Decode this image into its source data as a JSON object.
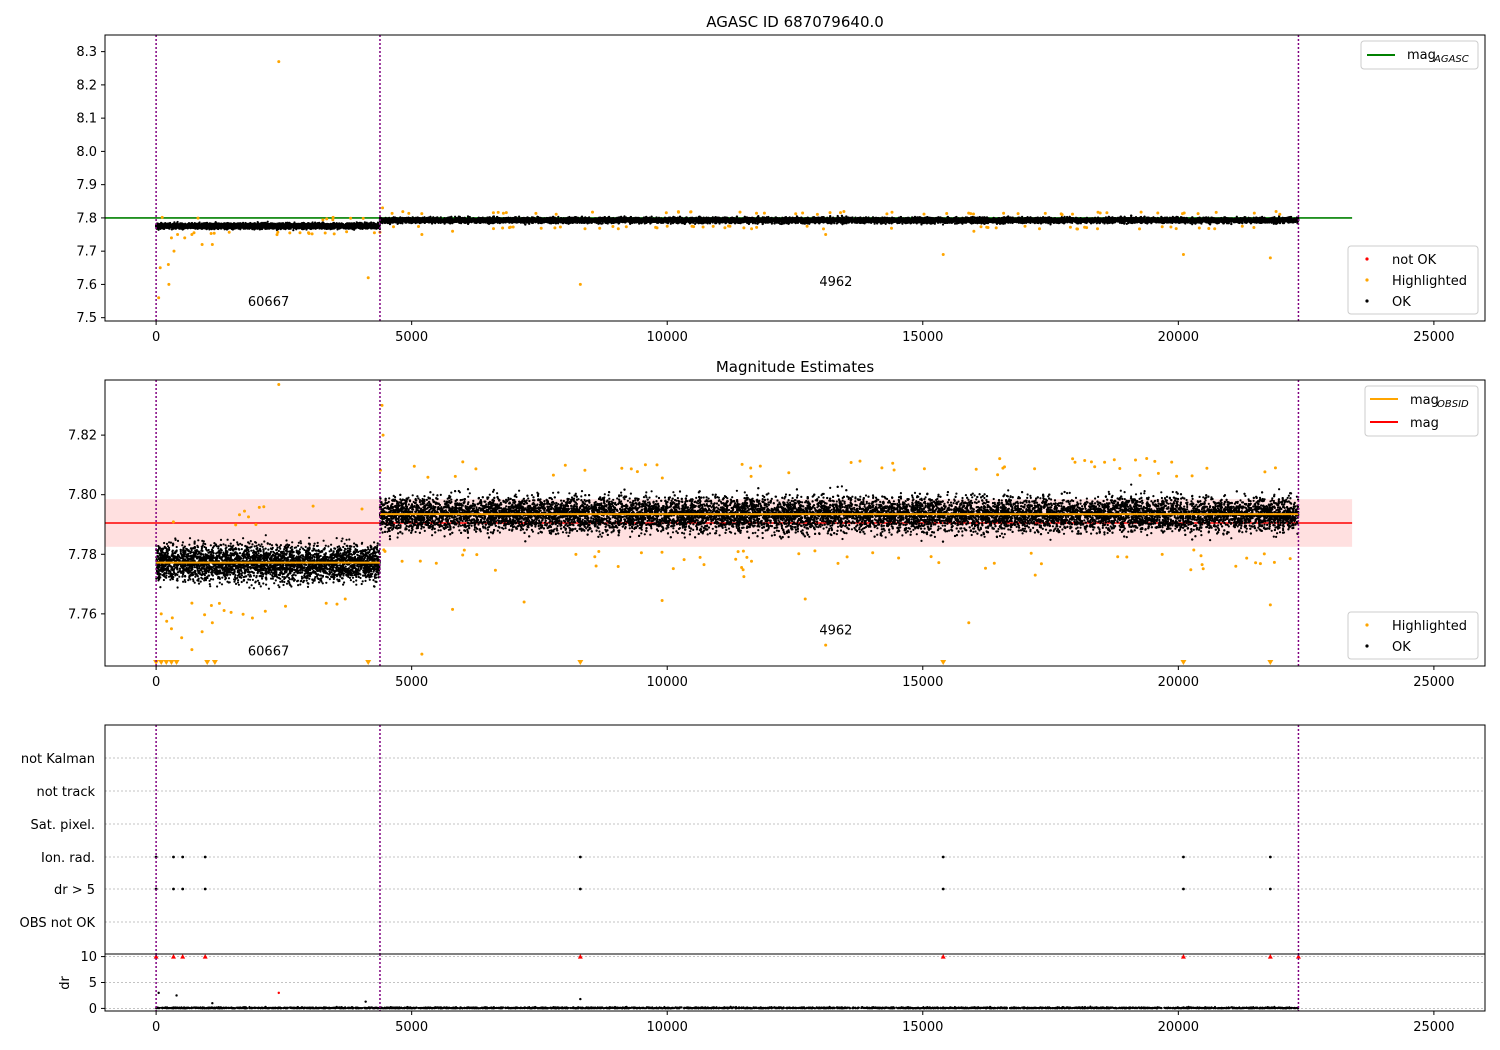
{
  "chart_data": [
    {
      "type": "scatter",
      "title": "AGASC ID 687079640.0",
      "xlim": [
        -1000,
        26000
      ],
      "ylim": [
        7.49,
        8.35
      ],
      "xticks": [
        0,
        5000,
        10000,
        15000,
        20000,
        25000
      ],
      "yticks": [
        7.5,
        7.6,
        7.7,
        7.8,
        7.9,
        8.0,
        8.1,
        8.2,
        8.3
      ],
      "grid": false,
      "legend_top": {
        "placement": "top-right",
        "entries": [
          {
            "label": "mag",
            "sub": "AGASC",
            "color": "#008000",
            "kind": "line"
          }
        ]
      },
      "legend_bottom": {
        "placement": "bottom-right",
        "entries": [
          {
            "label": "not OK",
            "color": "#ff0000",
            "kind": "dot"
          },
          {
            "label": "Highlighted",
            "color": "#ffa500",
            "kind": "dot"
          },
          {
            "label": "OK",
            "color": "#000000",
            "kind": "dot"
          }
        ]
      },
      "reference_lines": [
        {
          "name": "mag_AGASC",
          "y": 7.8,
          "x_range": [
            -1000,
            23400
          ],
          "color": "#008000"
        }
      ],
      "vlines": [
        0,
        4380,
        22350
      ],
      "annotations": [
        {
          "text": "60667",
          "x": 2200,
          "y": 7.535
        },
        {
          "text": "4962",
          "x": 13300,
          "y": 7.595
        }
      ],
      "segments": [
        {
          "obsid": "60667",
          "x_range": [
            0,
            4380
          ],
          "mean": 7.776,
          "spread": 0.006
        },
        {
          "obsid": "4962",
          "x_range": [
            4380,
            22350
          ],
          "mean": 7.793,
          "spread": 0.006
        }
      ],
      "highlighted_points": [
        {
          "x": 2400,
          "y": 8.27
        },
        {
          "x": 80,
          "y": 7.65
        },
        {
          "x": 50,
          "y": 7.56
        },
        {
          "x": 240,
          "y": 7.66
        },
        {
          "x": 250,
          "y": 7.6
        },
        {
          "x": 300,
          "y": 7.74
        },
        {
          "x": 350,
          "y": 7.7
        },
        {
          "x": 420,
          "y": 7.75
        },
        {
          "x": 560,
          "y": 7.74
        },
        {
          "x": 700,
          "y": 7.75
        },
        {
          "x": 900,
          "y": 7.72
        },
        {
          "x": 1100,
          "y": 7.72
        },
        {
          "x": 4150,
          "y": 7.62
        },
        {
          "x": 4430,
          "y": 7.83
        },
        {
          "x": 5200,
          "y": 7.75
        },
        {
          "x": 8300,
          "y": 7.6
        },
        {
          "x": 13100,
          "y": 7.75
        },
        {
          "x": 15400,
          "y": 7.69
        },
        {
          "x": 20100,
          "y": 7.69
        },
        {
          "x": 21800,
          "y": 7.68
        },
        {
          "x": 5800,
          "y": 7.76
        },
        {
          "x": 9800,
          "y": 7.77
        },
        {
          "x": 11500,
          "y": 7.77
        },
        {
          "x": 16000,
          "y": 7.76
        }
      ]
    },
    {
      "type": "scatter",
      "title": "Magnitude Estimates",
      "xlim": [
        -1000,
        26000
      ],
      "ylim": [
        7.7425,
        7.8385
      ],
      "xticks": [
        0,
        5000,
        10000,
        15000,
        20000,
        25000
      ],
      "yticks": [
        7.76,
        7.78,
        7.8,
        7.82
      ],
      "grid": false,
      "legend_top": {
        "placement": "top-right",
        "entries": [
          {
            "label": "mag",
            "sub": "OBSID",
            "color": "#ffa500",
            "kind": "line"
          },
          {
            "label": "mag",
            "sub": "",
            "color": "#ff0000",
            "kind": "line"
          }
        ]
      },
      "legend_bottom": {
        "placement": "bottom-right",
        "entries": [
          {
            "label": "Highlighted",
            "color": "#ffa500",
            "kind": "dot"
          },
          {
            "label": "OK",
            "color": "#000000",
            "kind": "dot"
          }
        ]
      },
      "mag_line": {
        "y": 7.7905,
        "band": [
          7.7825,
          7.7985
        ],
        "x_range": [
          -1000,
          23400
        ],
        "color": "#ff0000"
      },
      "obsid_lines": [
        {
          "obsid": "60667",
          "y": 7.7772,
          "x_range": [
            0,
            4380
          ]
        },
        {
          "obsid": "4962",
          "y": 7.7935,
          "x_range": [
            4380,
            22350
          ]
        }
      ],
      "vlines": [
        0,
        4380,
        22350
      ],
      "annotations": [
        {
          "text": "60667",
          "x": 2200,
          "y": 7.746
        },
        {
          "text": "4962",
          "x": 13300,
          "y": 7.753
        }
      ],
      "segments": [
        {
          "obsid": "60667",
          "x_range": [
            0,
            4380
          ],
          "mean": 7.7772,
          "spread": 0.0045
        },
        {
          "obsid": "4962",
          "x_range": [
            4380,
            22350
          ],
          "mean": 7.7935,
          "spread": 0.0043
        }
      ],
      "highlighted_points": [
        {
          "x": 2400,
          "y": 7.837
        },
        {
          "x": 4420,
          "y": 7.83
        },
        {
          "x": 4440,
          "y": 7.82
        },
        {
          "x": 5200,
          "y": 7.7465
        },
        {
          "x": 5800,
          "y": 7.7615
        },
        {
          "x": 7200,
          "y": 7.764
        },
        {
          "x": 9900,
          "y": 7.7645
        },
        {
          "x": 12700,
          "y": 7.765
        },
        {
          "x": 13100,
          "y": 7.7495
        },
        {
          "x": 15900,
          "y": 7.757
        },
        {
          "x": 21800,
          "y": 7.763
        },
        {
          "x": 11500,
          "y": 7.7725
        },
        {
          "x": 17200,
          "y": 7.773
        },
        {
          "x": 100,
          "y": 7.76
        },
        {
          "x": 300,
          "y": 7.755
        },
        {
          "x": 500,
          "y": 7.752
        },
        {
          "x": 700,
          "y": 7.748
        },
        {
          "x": 900,
          "y": 7.754
        },
        {
          "x": 1100,
          "y": 7.757
        },
        {
          "x": 3700,
          "y": 7.765
        },
        {
          "x": 6000,
          "y": 7.811
        },
        {
          "x": 9800,
          "y": 7.81
        },
        {
          "x": 14200,
          "y": 7.809
        },
        {
          "x": 18300,
          "y": 7.811
        },
        {
          "x": 21900,
          "y": 7.809
        }
      ],
      "below_axis_markers": [
        0,
        100,
        200,
        300,
        400,
        1000,
        1150,
        4150,
        8300,
        15400,
        20100,
        21800
      ]
    },
    {
      "type": "scatter",
      "title": "",
      "xlim": [
        -1000,
        26000
      ],
      "xticks": [
        0,
        5000,
        10000,
        15000,
        20000,
        25000
      ],
      "flag_categories": [
        "not Kalman",
        "not track",
        "Sat. pixel.",
        "Ion. rad.",
        "dr > 5",
        "OBS not OK"
      ],
      "flag_points": {
        "Ion. rad.": [
          0,
          340,
          520,
          960,
          8300,
          15400,
          20100,
          21800
        ],
        "dr > 5": [
          0,
          340,
          520,
          960,
          8300,
          15400,
          20100,
          21800
        ]
      },
      "vlines": [
        0,
        4380,
        22350
      ]
    },
    {
      "type": "scatter",
      "title": "",
      "ylabel": "dr",
      "xlim": [
        -1000,
        26000
      ],
      "ylim": [
        -0.5,
        10.5
      ],
      "xticks": [
        0,
        5000,
        10000,
        15000,
        20000,
        25000
      ],
      "yticks": [
        0,
        5,
        10
      ],
      "clipped_markers": [
        0,
        340,
        520,
        960,
        8300,
        15400,
        20100,
        21800,
        22350
      ],
      "outliers": [
        {
          "x": 50,
          "y": 3.0
        },
        {
          "x": 400,
          "y": 2.5
        },
        {
          "x": 2400,
          "y": 3.0
        },
        {
          "x": 8300,
          "y": 1.8
        },
        {
          "x": 4100,
          "y": 1.3
        },
        {
          "x": 1100,
          "y": 1.0
        }
      ],
      "vlines": [
        0,
        4380,
        22350
      ]
    }
  ]
}
